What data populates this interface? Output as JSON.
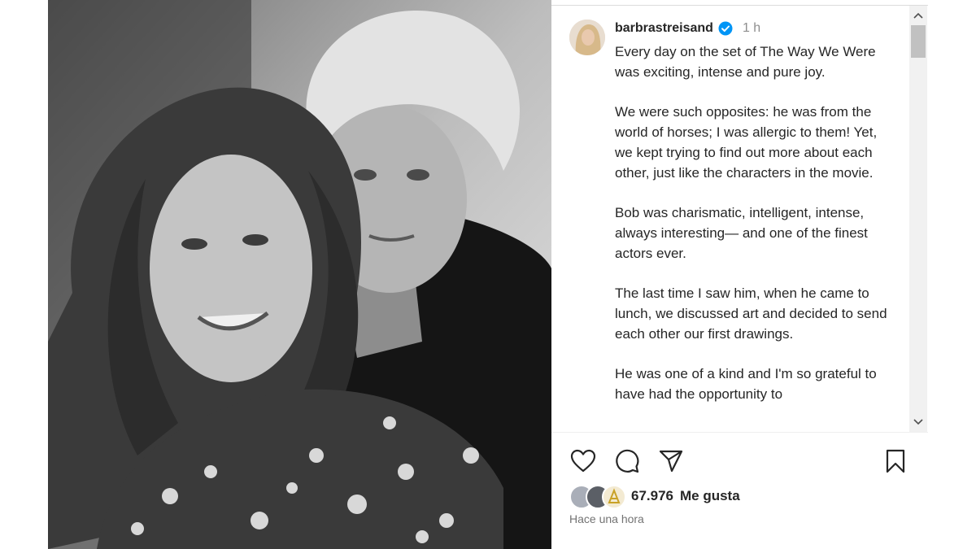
{
  "post": {
    "username": "barbrastreisand",
    "time_ago": "1 h",
    "caption_paragraphs": [
      "Every day on the set of The Way We Were was exciting, intense and pure joy.",
      "We were such opposites: he was from the world of horses; I was allergic to them! Yet, we kept trying to find out more about each other, just like the characters in the movie.",
      "Bob was charismatic, intelligent, intense, always interesting— and one of the finest actors ever.",
      "The last time I saw him, when he came to lunch, we discussed art and decided to send each other our first drawings.",
      "He was one of a kind and I'm so grateful to have had the opportunity to"
    ],
    "likes_count": "67.976",
    "likes_label": "Me gusta",
    "date_text": "Hace una hora"
  },
  "icons": {
    "verified": "verified-badge-icon",
    "like": "heart-icon",
    "comment": "comment-bubble-icon",
    "share": "paper-plane-icon",
    "save": "bookmark-icon",
    "scroll_up": "chevron-up-icon",
    "scroll_down": "chevron-down-icon"
  },
  "colors": {
    "verified_blue": "#0095f6",
    "text": "#262626",
    "muted": "#737373"
  }
}
